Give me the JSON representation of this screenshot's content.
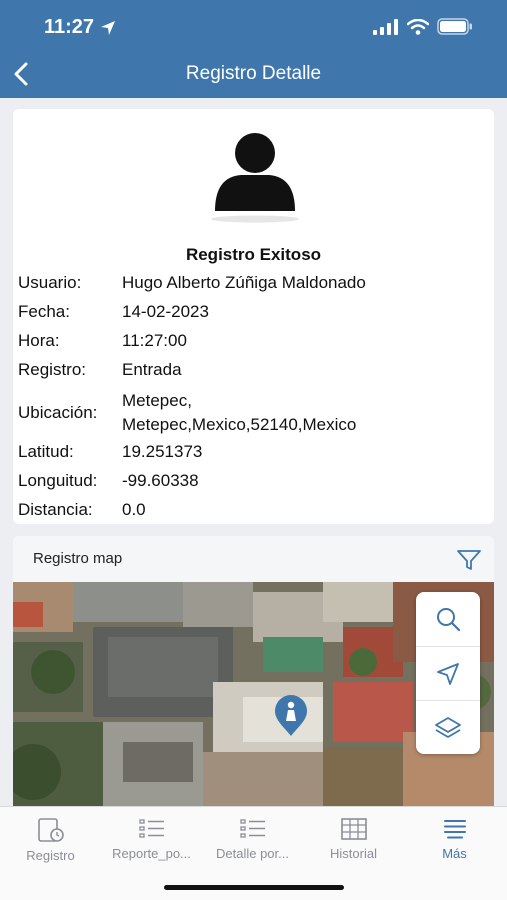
{
  "status_bar": {
    "time": "11:27"
  },
  "header": {
    "title": "Registro Detalle"
  },
  "card": {
    "title": "Registro Exitoso",
    "fields": [
      {
        "label": "Usuario:",
        "value": "Hugo Alberto Zúñiga Maldonado"
      },
      {
        "label": "Fecha:",
        "value": "14-02-2023"
      },
      {
        "label": "Hora:",
        "value": "11:27:00"
      },
      {
        "label": "Registro:",
        "value": "Entrada"
      },
      {
        "label": "Ubicación:",
        "value_line1": "Metepec,",
        "value_line2": "Metepec,Mexico,52140,Mexico"
      },
      {
        "label": "Latitud:",
        "value": "19.251373"
      },
      {
        "label": "Longuitud:",
        "value": "-99.60338"
      },
      {
        "label": "Distancia:",
        "value": "0.0"
      }
    ]
  },
  "map": {
    "title": "Registro map"
  },
  "tabs": [
    {
      "label": "Registro",
      "icon": "clock-document-icon"
    },
    {
      "label": "Reporte_po...",
      "icon": "list-icon"
    },
    {
      "label": "Detalle por...",
      "icon": "list-icon"
    },
    {
      "label": "Historial",
      "icon": "table-icon"
    },
    {
      "label": "Más",
      "icon": "menu-icon"
    }
  ],
  "colors": {
    "accent": "#3f77ac",
    "tab_inactive": "#8a8f95"
  }
}
